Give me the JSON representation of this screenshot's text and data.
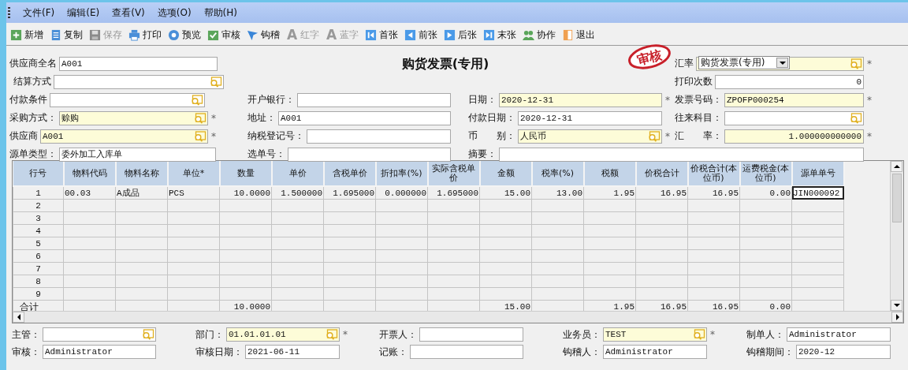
{
  "menu": [
    "文件(F)",
    "编辑(E)",
    "查看(V)",
    "选项(O)",
    "帮助(H)"
  ],
  "toolbar": [
    {
      "label": "新增",
      "disabled": false
    },
    {
      "label": "复制",
      "disabled": false
    },
    {
      "label": "保存",
      "disabled": true
    },
    {
      "label": "打印",
      "disabled": false
    },
    {
      "label": "预览",
      "disabled": false
    },
    {
      "label": "审核",
      "disabled": false
    },
    {
      "label": "钩稽",
      "disabled": false
    },
    {
      "label": "红字",
      "disabled": true,
      "glyph": "A"
    },
    {
      "label": "蓝字",
      "disabled": true,
      "glyph": "A"
    },
    {
      "label": "首张",
      "disabled": false
    },
    {
      "label": "前张",
      "disabled": false
    },
    {
      "label": "后张",
      "disabled": false
    },
    {
      "label": "末张",
      "disabled": false
    },
    {
      "label": "协作",
      "disabled": false
    },
    {
      "label": "退出",
      "disabled": false
    }
  ],
  "header": {
    "title": "购货发票(专用)",
    "stamp": "审核",
    "type_dropdown": {
      "value": "购货发票(专用)"
    },
    "fields": [
      {
        "label": "供应商全名",
        "value": "A001",
        "required": false,
        "lookup": false
      },
      {
        "label": "汇率",
        "required": true,
        "lookup": true,
        "mark": "*"
      },
      {
        "label": "结算方式",
        "required": false,
        "lookup": true
      },
      {
        "label": "打印次数",
        "value": "0",
        "required": false,
        "lookup": false,
        "align_right": true
      },
      {
        "label": "付款条件",
        "required": false,
        "lookup": true
      },
      {
        "label": "开户银行：",
        "required": false,
        "lookup": false
      },
      {
        "label": "日期：",
        "value": "2020-12-31",
        "required": true,
        "lookup": false,
        "mark": "*"
      },
      {
        "label": "发票号码：",
        "value": "ZPOFP000254",
        "required": true,
        "lookup": false,
        "mark": "*"
      },
      {
        "label": "采购方式：",
        "value": "赊购",
        "required": true,
        "lookup": true,
        "mark": "*"
      },
      {
        "label": "地址：",
        "value": "A001",
        "required": false,
        "lookup": false
      },
      {
        "label": "付款日期：",
        "value": "2020-12-31",
        "required": false,
        "lookup": false
      },
      {
        "label": "往来科目：",
        "required": false,
        "lookup": true
      },
      {
        "label": "供应商",
        "value": "A001",
        "required": true,
        "lookup": true,
        "mark": "*"
      },
      {
        "label": "纳税登记号：",
        "required": false,
        "lookup": false
      },
      {
        "label": "币　　别：",
        "value": "人民币",
        "required": true,
        "lookup": true,
        "mark": "*"
      },
      {
        "label": "汇　　率：",
        "value": "1.000000000000",
        "required": true,
        "lookup": false,
        "align_right": true,
        "mark": "*"
      },
      {
        "label": "源单类型：",
        "value": "委外加工入库单",
        "required": false,
        "lookup": false
      },
      {
        "label": "选单号：",
        "required": false,
        "lookup": false
      },
      {
        "label": "摘要：",
        "required": false,
        "lookup": false
      }
    ]
  },
  "table": {
    "columns": [
      "行号",
      "物料代码",
      "物料名称",
      "单位*",
      "数量",
      "单价",
      "含税单价",
      "折扣率(%)",
      "实际含税单价",
      "金额",
      "税率(%)",
      "税额",
      "价税合计",
      "价税合计(本位币)",
      "运费税金(本位币)",
      "源单单号"
    ],
    "rows": [
      {
        "number": "1",
        "cells": [
          {
            "text": "00.03",
            "focused": false
          },
          {
            "text": "A成品",
            "focused": false
          },
          {
            "text": "PCS",
            "focused": false
          },
          {
            "text": "10.0000",
            "focused": false
          },
          {
            "text": "1.500000",
            "focused": false
          },
          {
            "text": "1.695000",
            "focused": false
          },
          {
            "text": "0.000000",
            "focused": false
          },
          {
            "text": "1.695000",
            "focused": false
          },
          {
            "text": "15.00",
            "focused": false
          },
          {
            "text": "13.00",
            "focused": false
          },
          {
            "text": "1.95",
            "focused": false
          },
          {
            "text": "16.95",
            "focused": false
          },
          {
            "text": "16.95",
            "focused": false
          },
          {
            "text": "0.00",
            "focused": false
          },
          {
            "text": "JIN000092",
            "focused": true
          }
        ]
      },
      {
        "number": "2"
      },
      {
        "number": "3"
      },
      {
        "number": "4"
      },
      {
        "number": "5"
      },
      {
        "number": "6"
      },
      {
        "number": "7"
      },
      {
        "number": "8"
      },
      {
        "number": "9"
      }
    ],
    "total": {
      "label": "合计",
      "cells": [
        null,
        null,
        null,
        "10.0000",
        null,
        null,
        null,
        null,
        "15.00",
        null,
        "1.95",
        "16.95",
        "16.95",
        "0.00",
        null
      ]
    }
  },
  "footer": [
    {
      "label": "主管：",
      "required": false,
      "lookup": true
    },
    {
      "label": "部门：",
      "value": "01.01.01.01",
      "required": true,
      "lookup": true,
      "mark": "*"
    },
    {
      "label": "开票人：",
      "required": false,
      "lookup": false
    },
    {
      "label": "业务员：",
      "value": "TEST",
      "required": true,
      "lookup": true,
      "mark": "*"
    },
    {
      "label": "制单人：",
      "value": "Administrator",
      "required": false,
      "lookup": false
    },
    {
      "label": "审核：",
      "value": "Administrator",
      "required": false,
      "lookup": false
    },
    {
      "label": "审核日期：",
      "value": "2021-06-11",
      "required": false,
      "lookup": false
    },
    {
      "label": "记账：",
      "required": false,
      "lookup": false
    },
    {
      "label": "钩稽人：",
      "value": "Administrator",
      "required": false,
      "lookup": false
    },
    {
      "label": "钩稽期间：",
      "value": "2020-12",
      "required": false,
      "lookup": false
    }
  ]
}
